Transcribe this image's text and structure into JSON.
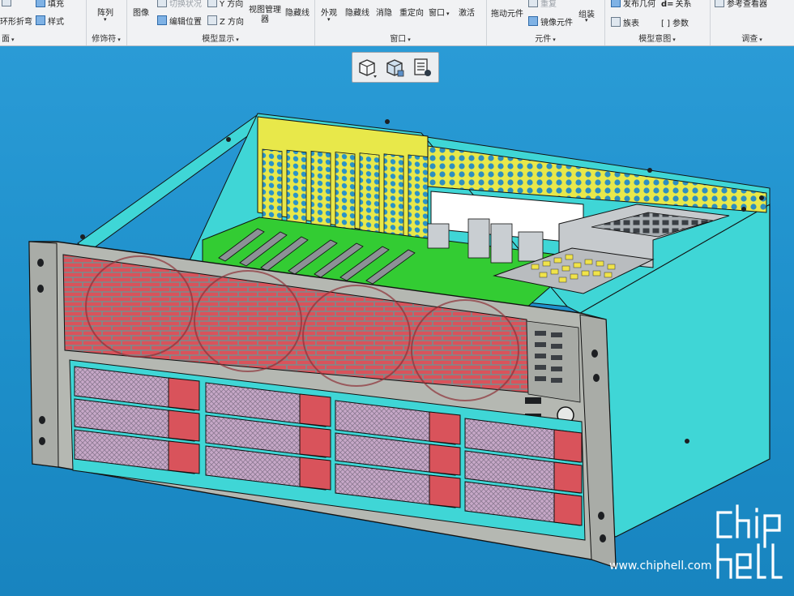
{
  "ribbon": {
    "groups": [
      {
        "label": "面"
      },
      {
        "label": "修饰符"
      },
      {
        "label": "模型显示"
      },
      {
        "label": "窗口"
      },
      {
        "label": "元件"
      },
      {
        "label": "模型意图"
      },
      {
        "label": "调查"
      }
    ],
    "buttons": {
      "ring_fold": "环形折弯",
      "fill": "填充",
      "style": "样式",
      "array": "阵列",
      "image": "图像",
      "switch_state": "切换状况",
      "edit_position": "编辑位置",
      "y_direction": "Y 方向",
      "z_direction": "Z 方向",
      "view_manager": "视图管理器",
      "hide_line": "隐藏线",
      "appearance": "外观",
      "hidden_line": "隐藏线",
      "eliminate": "消隐",
      "reorient": "重定向",
      "window": "窗口",
      "activate": "激活",
      "drag_component": "拖动元件",
      "repeat": "重复",
      "mirror_component": "镜像元件",
      "assemble": "组装",
      "publish_geometry": "发布几何",
      "relations": "关系",
      "family_table": "族表",
      "parameters": "参数",
      "reference_viewer": "参考查看器",
      "relations_prefix": "d=",
      "parameters_prefix": "[ ]"
    }
  },
  "watermark": {
    "url": "www.chiphell.com",
    "logo_text": "chip hell"
  },
  "colors": {
    "viewport": "#1f94cc",
    "chassis": "#3fd6d6",
    "front_panel": "#b5b8b2",
    "fan": "#d9535b",
    "pcb": "#33cc33",
    "bracket": "#e8e84a"
  }
}
